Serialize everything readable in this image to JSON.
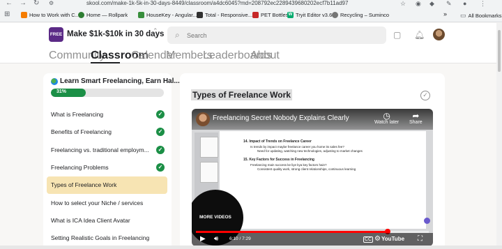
{
  "browser": {
    "url": "skool.com/make-1k-5k-in-30-days-8449/classroom/a4dc6045?md=208792ec2289439680202ecf7b11ad97",
    "bookmarks": [
      {
        "label": "How to Work with C...",
        "icon": "orange-square-icon",
        "color": "#f57c00"
      },
      {
        "label": "Home — Rollpark",
        "icon": "rollpark-icon",
        "color": "#2e7d32"
      },
      {
        "label": "HouseKey - Angular...",
        "icon": "housekey-icon",
        "color": "#388e3c"
      },
      {
        "label": "Total - Responsive...",
        "icon": "total-icon",
        "color": "#303030"
      },
      {
        "label": "PET Bottles",
        "icon": "pet-icon",
        "color": "#c62828"
      },
      {
        "label": "Tryit Editor v3.6",
        "icon": "w3-icon",
        "color": "#04aa6d"
      },
      {
        "label": "Recycling – Suminco",
        "icon": "globe-icon",
        "color": "#757575"
      }
    ],
    "more_bookmarks": "»",
    "all_bookmarks": "All Bookmarks"
  },
  "header": {
    "logo_text": "FREE",
    "group_name": "Make $1k-$10k in 30 days",
    "search_placeholder": "Search",
    "tabs": [
      "Community",
      "Classroom",
      "Calendar",
      "Members",
      "Leaderboards",
      "About"
    ],
    "active_tab": "Classroom"
  },
  "sidebar": {
    "course_title": "Learn Smart Freelancing, Earn Hal...",
    "progress_label": "31%",
    "progress_fraction": 0.31,
    "lessons": [
      {
        "label": "What is Freelancing",
        "done": true,
        "active": false
      },
      {
        "label": "Benefits of Freelancing",
        "done": true,
        "active": false
      },
      {
        "label": "Freelancing vs. traditional employm...",
        "done": true,
        "active": false
      },
      {
        "label": "Freelancing Problems",
        "done": true,
        "active": false
      },
      {
        "label": "Types of Freelance Work",
        "done": false,
        "active": true
      },
      {
        "label": "How to select your Niche / services",
        "done": false,
        "active": false
      },
      {
        "label": "What is ICA Idea Client Avatar",
        "done": false,
        "active": false
      },
      {
        "label": "Setting Realistic Goals in Freelancing",
        "done": false,
        "active": false
      }
    ]
  },
  "main": {
    "lesson_title": "Types of Freelance Work",
    "video": {
      "title": "Freelancing Secret Nobody Explains Clearly",
      "watch_later": "Watch later",
      "share": "Share",
      "more_videos": "MORE VIDEOS",
      "time": "6:10 / 7:29",
      "progress_fraction": 0.824,
      "youtube": "YouTube",
      "doc_lines": [
        "14. Impact of Trends on Freelance Career",
        "Is trends by impact maybe freelance career you home its sales fee?",
        "Need for updating, watching new technologies, adjusting to market changes",
        "15. Key Factors for Success in Freelancing",
        "Freelancing main success ke liye kya key factors hain?",
        "Consistent quality work, strong client relationships, continuous learning"
      ]
    }
  }
}
